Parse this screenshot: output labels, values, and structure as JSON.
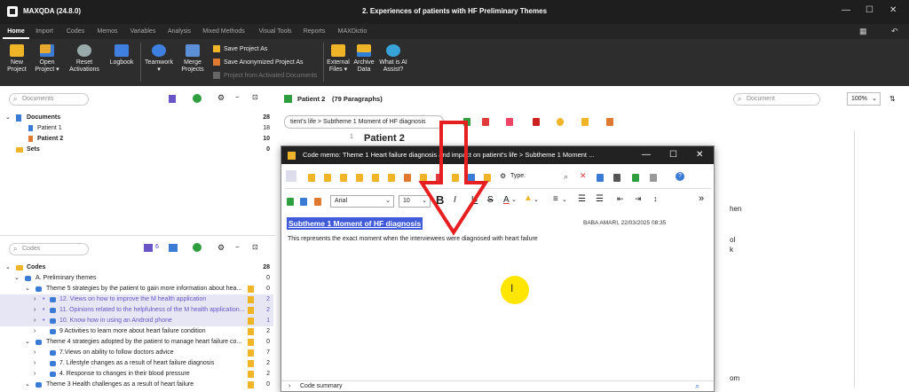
{
  "app": {
    "name": "MAXQDA (24.8.0)",
    "doc_title": "2. Experiences of patients with HF Preliminary Themes",
    "win_min": "—",
    "win_max": "☐",
    "win_close": "✕"
  },
  "menu": {
    "tabs": [
      "Home",
      "Import",
      "Codes",
      "Memos",
      "Variables",
      "Analysis",
      "Mixed Methods",
      "Visual Tools",
      "Reports",
      "MAXDictio"
    ],
    "active": "Home"
  },
  "ribbon": {
    "buttons": [
      {
        "label": "New\nProject",
        "icon": "folder-icon"
      },
      {
        "label": "Open\nProject ▾",
        "icon": "folder-open-icon"
      },
      {
        "label": "Reset\nActivations",
        "icon": "reset-icon"
      },
      {
        "label": "Logbook",
        "icon": "book-icon"
      },
      {
        "label": "Teamwork\n▾",
        "icon": "team-icon"
      },
      {
        "label": "Merge\nProjects",
        "icon": "merge-icon"
      },
      {
        "label": "External\nFiles ▾",
        "icon": "external-files-icon"
      },
      {
        "label": "Archive\nData",
        "icon": "archive-icon"
      },
      {
        "label": "What is AI\nAssist?",
        "icon": "ai-icon"
      }
    ],
    "small": [
      "Save Project As",
      "Save Anonymized Project As",
      "Project from Activated Documents"
    ]
  },
  "documents": {
    "search_placeholder": "Documents",
    "items": [
      {
        "label": "Documents",
        "count": "28"
      },
      {
        "label": "Patient 1",
        "count": "18"
      },
      {
        "label": "Patient 2",
        "count": "10"
      },
      {
        "label": "Sets",
        "count": "0"
      }
    ]
  },
  "codes": {
    "search_placeholder": "Codes",
    "toolbar_count": "6",
    "items": [
      {
        "label": "Codes",
        "count": "28"
      },
      {
        "label": "A. Preliminary themes",
        "count": "0"
      },
      {
        "label": "Theme 5 strategies by the patient to gain more information about hea...",
        "count": "0"
      },
      {
        "label": "12. Views on how to improve the M health application",
        "count": "2"
      },
      {
        "label": "11. Opinions related to the helpfulness of the M health application...",
        "count": "2"
      },
      {
        "label": "10. Know how in using an Android phone",
        "count": "1"
      },
      {
        "label": "9 Activities to learn more about heart failure condition",
        "count": "2"
      },
      {
        "label": "Theme 4 strategies adopted by the patient to manage heart failure co...",
        "count": "0"
      },
      {
        "label": "7.Views on ability to follow doctors advice",
        "count": "7"
      },
      {
        "label": "7. Lifestyle changes as a result of heart failure diagnosis",
        "count": "2"
      },
      {
        "label": "4. Response to changes in their blood pressure",
        "count": "2"
      },
      {
        "label": "Theme 3 Health challenges as a result of heart failure",
        "count": "0"
      }
    ]
  },
  "browser": {
    "doc_label": "Patient 2",
    "paragraphs": "(79 Paragraphs)",
    "search_placeholder": "Document",
    "zoom": "100%",
    "breadcrumb": "tient's life > Subtheme 1 Moment of HF diagnosis",
    "para_num": "1",
    "para_title": "Patient 2",
    "right_frags": [
      "hen",
      "ol",
      "k",
      "om"
    ]
  },
  "memo": {
    "title": "Code memo: Theme 1 Heart failure diagnosis and impact on patient's life  > Subtheme 1 Moment ...",
    "type_label": "Type:",
    "font": "Arial",
    "size": "10",
    "heading": "Subtheme 1 Moment of HF diagnosis",
    "author": "BABA  AMARI, 22/03/2025 08:35",
    "body": "This represents the exact moment when the interviewees were diagnosed with heart failure",
    "summary": "Code summary",
    "cursor": "I"
  },
  "colors": {
    "arrow": "#e62020",
    "highlight": "#ffe600",
    "selection": "#3f5bd9"
  }
}
